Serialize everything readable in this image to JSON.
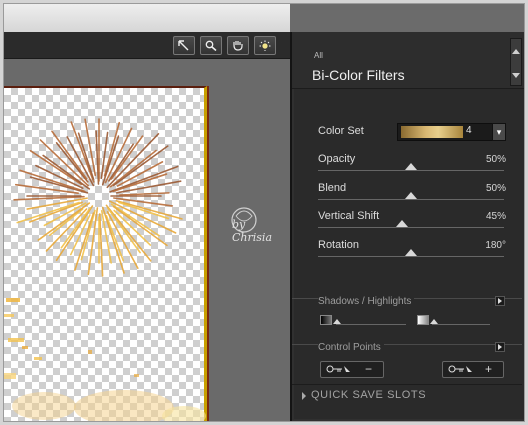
{
  "toolbar": {
    "tools": [
      {
        "icon": "arrow-pointer-icon"
      },
      {
        "icon": "zoom-icon"
      },
      {
        "icon": "hand-icon"
      },
      {
        "icon": "light-icon"
      }
    ]
  },
  "watermark": {
    "text": "by Chrisia"
  },
  "panel": {
    "category": "All",
    "filter_title": "Bi-Color Filters",
    "color_set": {
      "label": "Color Set",
      "value": "4"
    },
    "sliders": [
      {
        "label": "Opacity",
        "value": "50%",
        "level": 0.5
      },
      {
        "label": "Blend",
        "value": "50%",
        "level": 0.5
      },
      {
        "label": "Vertical Shift",
        "value": "45%",
        "level": 0.45
      },
      {
        "label": "Rotation",
        "value": "180°",
        "level": 0.5
      }
    ],
    "shadows_highlights": {
      "title": "Shadows / Highlights"
    },
    "control_points": {
      "title": "Control Points",
      "remove_symbol": "−",
      "add_symbol": "+"
    },
    "quick_save": {
      "title": "QUICK SAVE SLOTS"
    }
  }
}
